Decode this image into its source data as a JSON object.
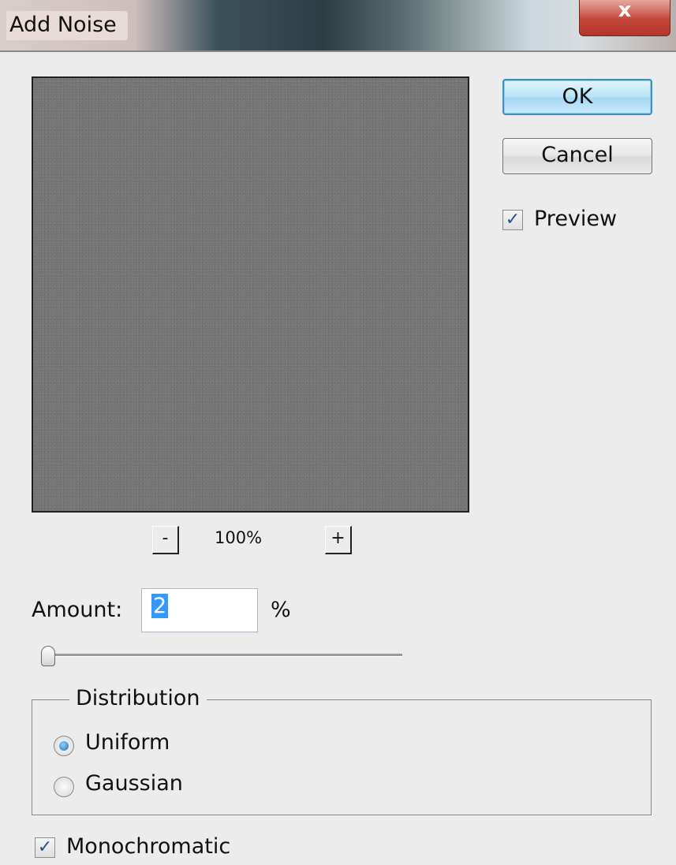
{
  "window": {
    "title": "Add Noise",
    "close_glyph": "x"
  },
  "preview_zoom": {
    "minus_label": "-",
    "level": "100%",
    "plus_label": "+"
  },
  "buttons": {
    "ok": "OK",
    "cancel": "Cancel"
  },
  "preview_option": {
    "label": "Preview",
    "checked": true
  },
  "amount": {
    "label": "Amount:",
    "value": "2",
    "unit": "%",
    "slider_value_percent": 2
  },
  "distribution": {
    "legend": "Distribution",
    "options": [
      {
        "label": "Uniform",
        "selected": true
      },
      {
        "label": "Gaussian",
        "selected": false
      }
    ]
  },
  "monochromatic": {
    "label": "Monochromatic",
    "checked": true
  },
  "check_glyph": "✓",
  "icons": [
    "close-icon",
    "check-icon",
    "radio-icon"
  ],
  "colors": {
    "preview_gray": "#757575",
    "ok_accent": "#3d8fbf",
    "selection": "#3399ff"
  }
}
